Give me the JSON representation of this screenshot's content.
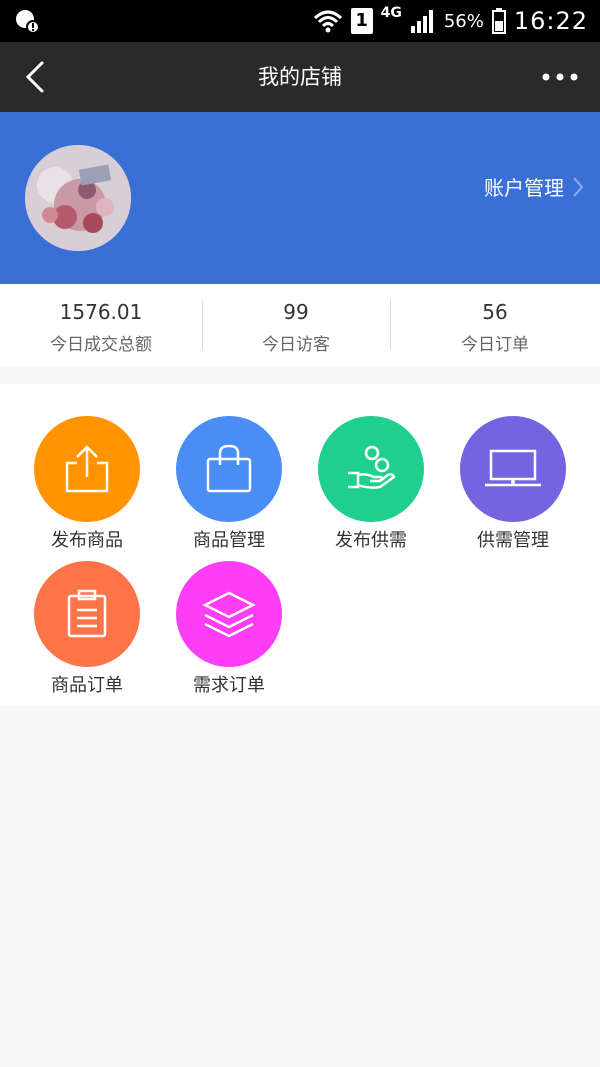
{
  "status_bar": {
    "sim_label": "1",
    "network": "4G",
    "battery_percent": "56%",
    "time": "16:22"
  },
  "nav": {
    "title": "我的店铺"
  },
  "banner": {
    "account_link": "账户管理"
  },
  "stats": [
    {
      "value": "1576.01",
      "label": "今日成交总额"
    },
    {
      "value": "99",
      "label": "今日访客"
    },
    {
      "value": "56",
      "label": "今日订单"
    }
  ],
  "menu": [
    {
      "label": "发布商品",
      "icon": "upload-icon",
      "color": "#ff9400"
    },
    {
      "label": "商品管理",
      "icon": "shopping-bag-icon",
      "color": "#4a8df5"
    },
    {
      "label": "发布供需",
      "icon": "hand-coins-icon",
      "color": "#1fcf8d"
    },
    {
      "label": "供需管理",
      "icon": "laptop-icon",
      "color": "#7464e0"
    },
    {
      "label": "商品订单",
      "icon": "clipboard-icon",
      "color": "#ff7348"
    },
    {
      "label": "需求订单",
      "icon": "layers-icon",
      "color": "#ff3df5"
    }
  ]
}
